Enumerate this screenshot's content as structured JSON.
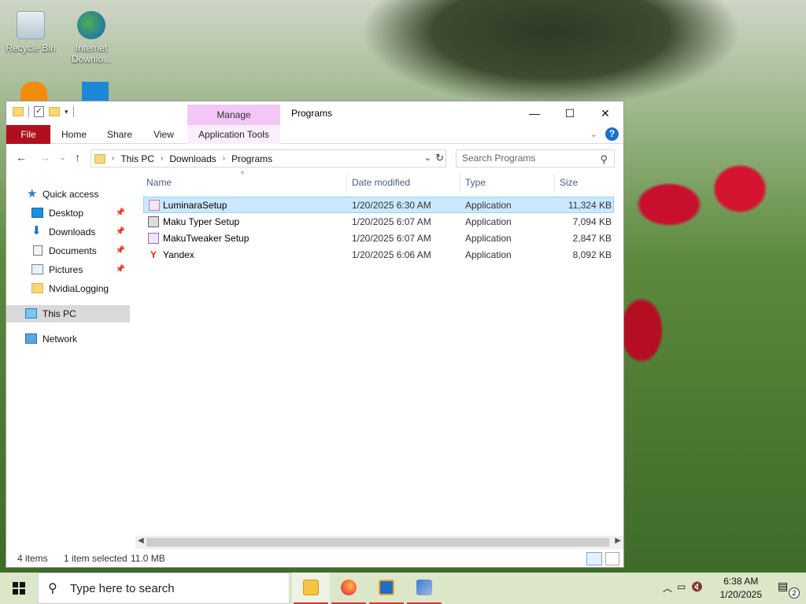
{
  "desktop": {
    "icons": [
      {
        "label": "Recycle Bin",
        "icon": "recycle-bin-icon"
      },
      {
        "label": "Internet Downlo...",
        "icon": "internet-download-manager-icon"
      }
    ]
  },
  "window": {
    "title": "Programs",
    "contextual_tab": "Manage",
    "controls": {
      "minimize": "—",
      "maximize": "☐",
      "close": "✕"
    }
  },
  "ribbon": {
    "tabs": [
      "File",
      "Home",
      "Share",
      "View",
      "Application Tools"
    ],
    "expand_icon": "chevron-down-icon",
    "help_label": "?"
  },
  "address": {
    "breadcrumbs": [
      "This PC",
      "Downloads",
      "Programs"
    ],
    "search_placeholder": "Search Programs"
  },
  "navpane": {
    "quick_access": "Quick access",
    "pinned": [
      {
        "label": "Desktop",
        "icon": "desktop-icon",
        "pinned": true
      },
      {
        "label": "Downloads",
        "icon": "downloads-icon",
        "pinned": true
      },
      {
        "label": "Documents",
        "icon": "documents-icon",
        "pinned": true
      },
      {
        "label": "Pictures",
        "icon": "pictures-icon",
        "pinned": true
      },
      {
        "label": "NvidiaLogging",
        "icon": "folder-icon",
        "pinned": false
      }
    ],
    "this_pc": "This PC",
    "network": "Network"
  },
  "filelist": {
    "columns": [
      "Name",
      "Date modified",
      "Type",
      "Size"
    ],
    "rows": [
      {
        "name": "LuminaraSetup",
        "date": "1/20/2025 6:30 AM",
        "type": "Application",
        "size": "11,324 KB",
        "selected": true
      },
      {
        "name": "Maku Typer Setup",
        "date": "1/20/2025 6:07 AM",
        "type": "Application",
        "size": "7,094 KB",
        "selected": false
      },
      {
        "name": "MakuTweaker Setup",
        "date": "1/20/2025 6:07 AM",
        "type": "Application",
        "size": "2,847 KB",
        "selected": false
      },
      {
        "name": "Yandex",
        "date": "1/20/2025 6:06 AM",
        "type": "Application",
        "size": "8,092 KB",
        "selected": false
      }
    ]
  },
  "status": {
    "items": "4 items",
    "selected": "1 item selected",
    "size": "11.0 MB"
  },
  "taskbar": {
    "search_placeholder": "Type here to search",
    "apps": [
      "file-explorer-icon",
      "firefox-icon",
      "virtualbox-icon",
      "installer-icon"
    ],
    "time": "6:38 AM",
    "date": "1/20/2025",
    "notification_count": "2"
  },
  "colors": {
    "file_tab": "#b0101d",
    "manage_tab": "#f2c7f5",
    "selection": "#cce8ff",
    "taskbar": "#dce7c9"
  }
}
